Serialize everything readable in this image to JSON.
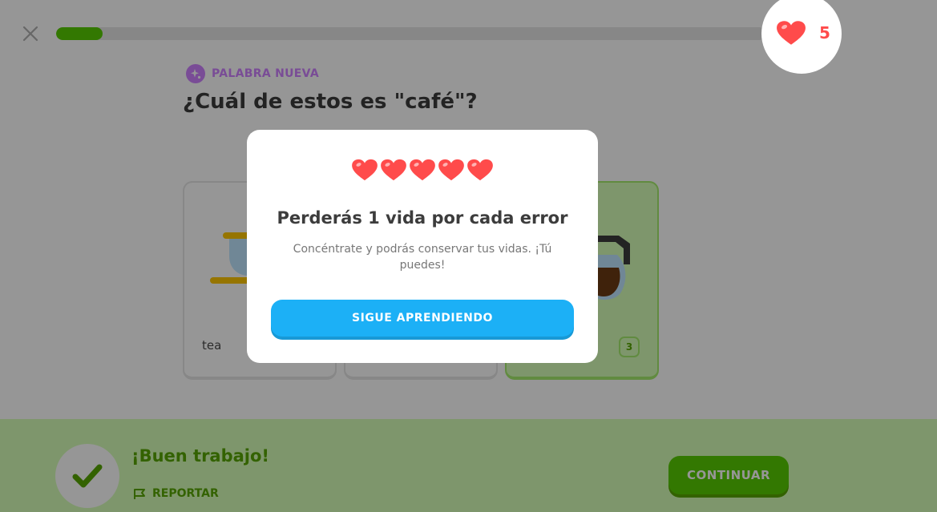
{
  "header": {
    "progress_percent": 6.5,
    "hearts_count": "5"
  },
  "challenge": {
    "tag_label": "PALABRA NUEVA",
    "question": "¿Cuál de estos es \"café\"?",
    "choices": [
      {
        "label": "tea",
        "key": ""
      },
      {
        "label": "",
        "key": ""
      },
      {
        "label": "",
        "key": "3"
      }
    ]
  },
  "footer": {
    "feedback_title": "¡Buen trabajo!",
    "report_label": "REPORTAR",
    "continue_label": "CONTINUAR"
  },
  "modal": {
    "hearts_shown": 5,
    "title": "Perderás 1 vida por cada error",
    "body": "Concéntrate y podrás conservar tus vidas. ¡Tú puedes!",
    "button_label": "SIGUE APRENDIENDO"
  },
  "colors": {
    "accent_green": "#58cc02",
    "heart_red": "#ff4b4b",
    "button_blue": "#1cb0f6",
    "new_word_purple": "#ce82ff"
  }
}
